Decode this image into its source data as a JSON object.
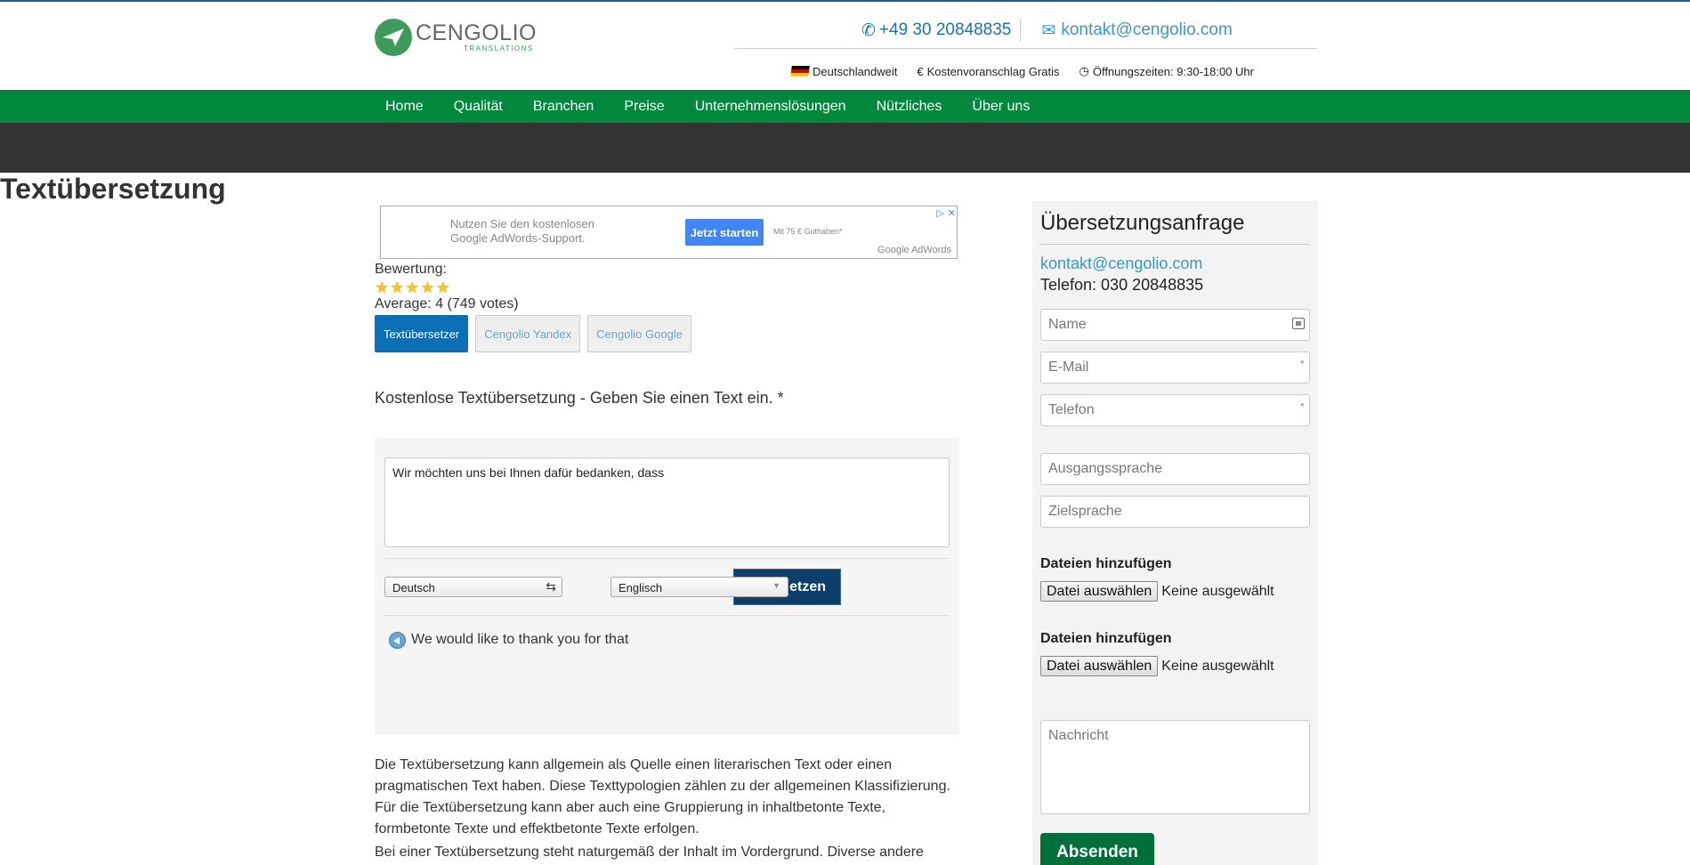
{
  "brand": {
    "name": "CENGOLIO",
    "sub": "TRANSLATIONS",
    "color": "#3e9a5a"
  },
  "header": {
    "phone": "+49 30 20848835",
    "email": "kontakt@cengolio.com",
    "meta": {
      "region": "Deutschlandweit",
      "quote": "Kostenvoranschlag Gratis",
      "hours": "Öffnungszeiten: 9:30-18:00 Uhr"
    }
  },
  "nav": {
    "items": [
      "Home",
      "Qualität",
      "Branchen",
      "Preise",
      "Unternehmenslösungen",
      "Nützliches",
      "Über uns"
    ],
    "color": "#00893c"
  },
  "page": {
    "title": "Textübersetzung"
  },
  "ad": {
    "text": "Nutzen Sie den kostenlosen Google AdWords-Support.",
    "button": "Jetzt starten",
    "small": "Mit 75 € Guthaben*",
    "brand": "Google AdWords"
  },
  "rating": {
    "label": "Bewertung:",
    "stars": 5,
    "average": "Average: 4 (749 votes)"
  },
  "tabs": [
    {
      "label": "Textübersetzer",
      "active": true
    },
    {
      "label": "Cengolio Yandex",
      "active": false
    },
    {
      "label": "Cengolio Google",
      "active": false
    }
  ],
  "translator": {
    "lead": "Kostenlose Textübersetzung - Geben Sie einen Text ein. *",
    "input_text": "Wir möchten uns bei Ihnen dafür bedanken, dass",
    "source_lang": "Deutsch",
    "target_lang": "Englisch",
    "button": "etzen",
    "result": "We would like to thank you for that"
  },
  "content": {
    "p1": [
      "Die Textübersetzung kann allgemein als Quelle einen literarischen Text oder einen",
      "pragmatischen Text haben. Diese Texttypologien zählen zu der allgemeinen Klassifizierung.",
      "Für die Textübersetzung kann aber auch eine Gruppierung in inhaltbetonte Texte,",
      "formbetonte Texte und effektbetonte Texte erfolgen."
    ],
    "p2": "Bei einer Textübersetzung steht naturgemäß der Inhalt im Vordergrund. Diverse andere"
  },
  "sidebar": {
    "title": "Übersetzungsanfrage",
    "email": "kontakt@cengolio.com",
    "phone": "Telefon: 030 20848835",
    "fields": {
      "name": "Name",
      "email": "E-Mail",
      "phone": "Telefon",
      "source": "Ausgangssprache",
      "target": "Zielsprache",
      "message": "Nachricht"
    },
    "files_label": "Dateien hinzufügen",
    "file_button": "Datei auswählen",
    "file_status": "Keine ausgewählt",
    "submit": "Absenden",
    "required_mark": "*"
  }
}
